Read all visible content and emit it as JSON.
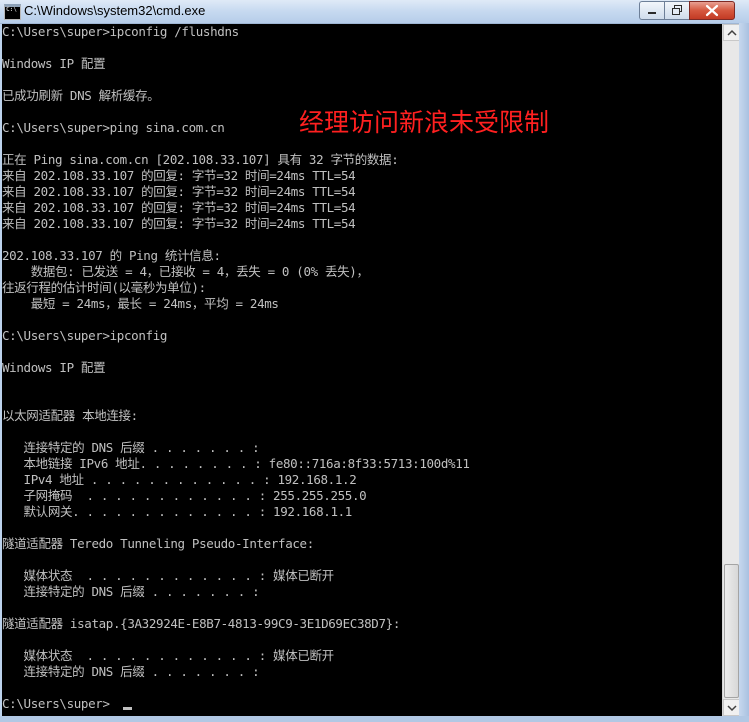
{
  "window": {
    "title": "C:\\Windows\\system32\\cmd.exe",
    "icon": "cmd-app-icon",
    "icon_text": "C:\\",
    "controls": [
      "minimize-icon",
      "maximize-icon",
      "close-icon"
    ]
  },
  "console": {
    "background": "#000000",
    "foreground": "#c0c0c0",
    "lines": [
      "C:\\Users\\super>ipconfig /flushdns",
      "",
      "Windows IP 配置",
      "",
      "已成功刷新 DNS 解析缓存。",
      "",
      "C:\\Users\\super>ping sina.com.cn",
      "",
      "正在 Ping sina.com.cn [202.108.33.107] 具有 32 字节的数据:",
      "来自 202.108.33.107 的回复: 字节=32 时间=24ms TTL=54",
      "来自 202.108.33.107 的回复: 字节=32 时间=24ms TTL=54",
      "来自 202.108.33.107 的回复: 字节=32 时间=24ms TTL=54",
      "来自 202.108.33.107 的回复: 字节=32 时间=24ms TTL=54",
      "",
      "202.108.33.107 的 Ping 统计信息:",
      "    数据包: 已发送 = 4，已接收 = 4，丢失 = 0 (0% 丢失)，",
      "往返行程的估计时间(以毫秒为单位):",
      "    最短 = 24ms，最长 = 24ms，平均 = 24ms",
      "",
      "C:\\Users\\super>ipconfig",
      "",
      "Windows IP 配置",
      "",
      "",
      "以太网适配器 本地连接:",
      "",
      "   连接特定的 DNS 后缀 . . . . . . . :",
      "   本地链接 IPv6 地址. . . . . . . . : fe80::716a:8f33:5713:100d%11",
      "   IPv4 地址 . . . . . . . . . . . . : 192.168.1.2",
      "   子网掩码  . . . . . . . . . . . . : 255.255.255.0",
      "   默认网关. . . . . . . . . . . . . : 192.168.1.1",
      "",
      "隧道适配器 Teredo Tunneling Pseudo-Interface:",
      "",
      "   媒体状态  . . . . . . . . . . . . : 媒体已断开",
      "   连接特定的 DNS 后缀 . . . . . . . :",
      "",
      "隧道适配器 isatap.{3A32924E-E8B7-4813-99C9-3E1D69EC38D7}:",
      "",
      "   媒体状态  . . . . . . . . . . . . : 媒体已断开",
      "   连接特定的 DNS 后缀 . . . . . . . :",
      "",
      "C:\\Users\\super>"
    ]
  },
  "annotation": {
    "text": "经理访问新浪未受限制",
    "color": "#ff2020"
  }
}
